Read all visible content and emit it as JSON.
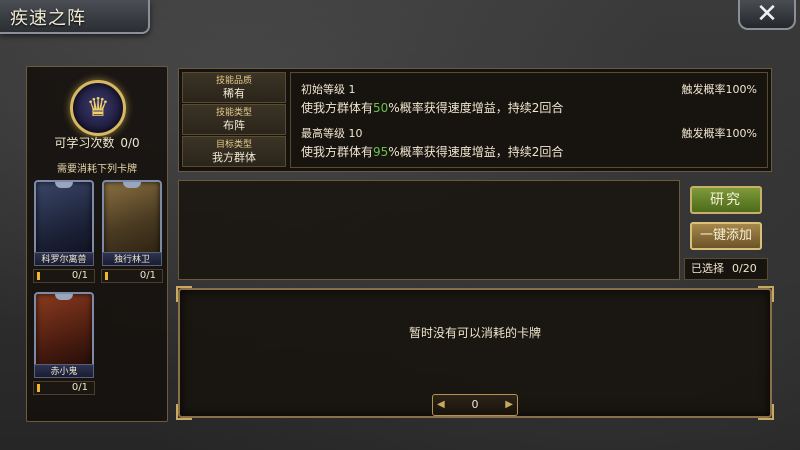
{
  "header": {
    "title": "疾速之阵",
    "close_icon": "close-x-icon"
  },
  "left_panel": {
    "emblem_icon": "golden-crown-emblem-icon",
    "learn_label": "可学习次数",
    "learn_value": "0/0",
    "need_label": "需要消耗下列卡牌",
    "cards": [
      {
        "name": "科罗尔离兽",
        "count": "0/1",
        "color": "#2a3350",
        "progress": 0
      },
      {
        "name": "独行林卫",
        "count": "0/1",
        "color": "#5a4a2a",
        "progress": 0
      },
      {
        "name": "赤小鬼",
        "count": "0/1",
        "color": "#6a2a1a",
        "progress": 0
      }
    ]
  },
  "info": {
    "quality_key": "技能品质",
    "quality_val": "稀有",
    "type_key": "技能类型",
    "type_val": "布阵",
    "target_key": "目标类型",
    "target_val": "我方群体",
    "initial_level": "初始等级 1",
    "initial_rate": "触发概率100%",
    "initial_desc_pre": "使我方群体有",
    "initial_percent": "50",
    "initial_desc_post": "%概率获得速度增益，持续2回合",
    "max_level": "最高等级 10",
    "max_rate": "触发概率100%",
    "max_desc_pre": "使我方群体有",
    "max_percent": "95",
    "max_desc_post": "%概率获得速度增益，持续2回合",
    "highlight_color": "#67c24a"
  },
  "actions": {
    "study_label": "研究",
    "add_label": "一键添加",
    "selected_label": "已选择",
    "selected_value": "0/20"
  },
  "bottom": {
    "empty_message": "暂时没有可以消耗的卡牌",
    "counter_value": "0"
  }
}
